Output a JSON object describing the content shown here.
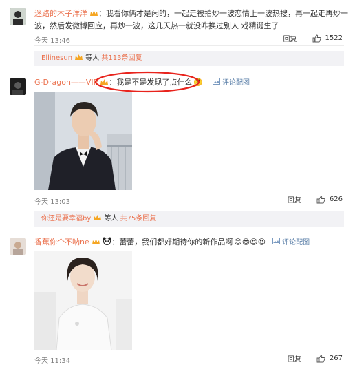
{
  "comments": [
    {
      "username": "迷路的木子洋洋",
      "text_line1": "：我看你俩才是闲的，一起走被拍炒一波恋情上一波热搜，再一起走再炒一",
      "text_line2": "波，然后发微博回应，再炒一波，这几天热一就没咋换过别人 戏精诞生了",
      "time": "今天 13:46",
      "reply_label": "回复",
      "likes": "1522",
      "sub": {
        "user": "Ellinesun",
        "suffix": "等人",
        "count_text": "共113条回复"
      }
    },
    {
      "username": "G-Dragon——VIP",
      "text": "：我是不是发现了点什么",
      "emoji": "🤔",
      "pic_link": "评论配图",
      "time": "今天 13:03",
      "reply_label": "回复",
      "likes": "626",
      "sub": {
        "user": "你还是要幸福by",
        "suffix": "等人",
        "count_text": "共75条回复"
      }
    },
    {
      "username": "香蕉你个不呐ne",
      "text": "：蕾蕾，我们都好期待你的新作品啊",
      "emoji": "😍😍😍😍",
      "pic_link": "评论配图",
      "time": "今天 11:34",
      "reply_label": "回复",
      "likes": "267"
    }
  ],
  "colors": {
    "accent": "#eb7350",
    "highlight_circle": "#e8231c",
    "sub_bg": "#f2f2f5"
  }
}
